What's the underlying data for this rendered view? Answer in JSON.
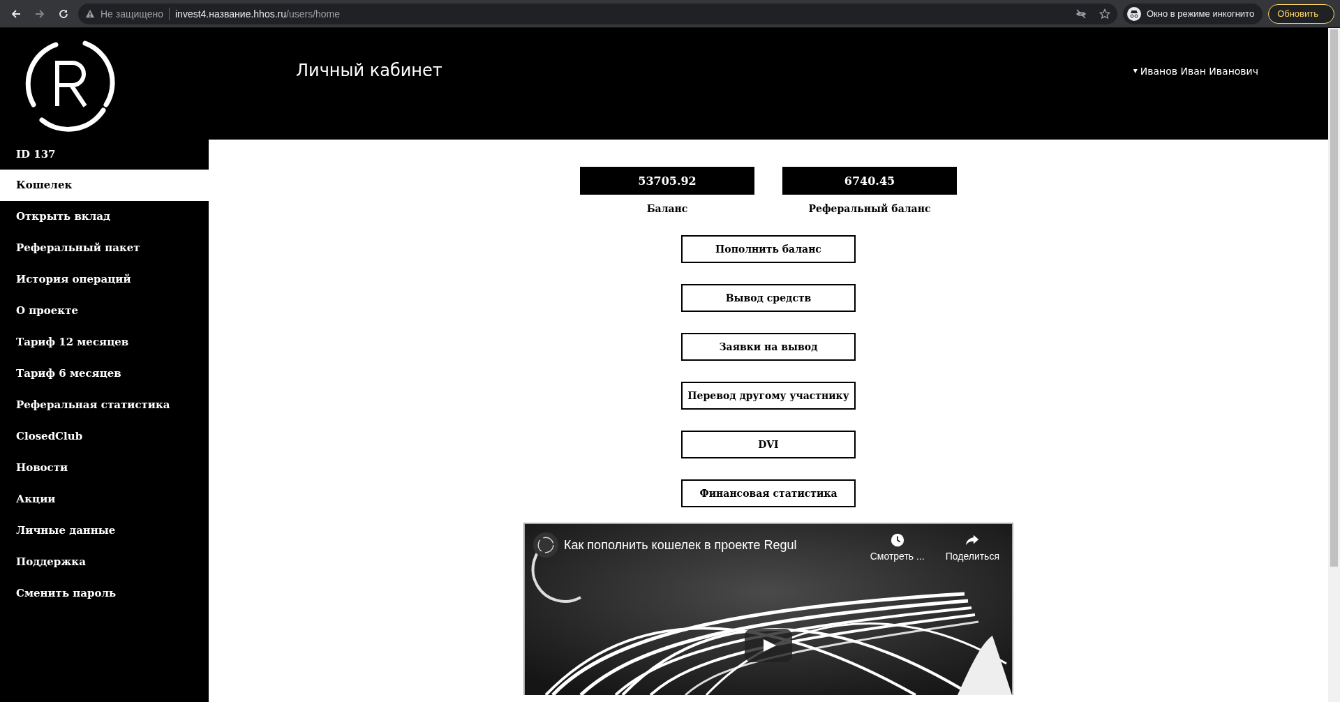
{
  "browser": {
    "security": "Не защищено",
    "url_host": "invest4.название.hhos.ru",
    "url_path": "/users/home",
    "incognito": "Окно в режиме инкогнито",
    "update_button": "Обновить"
  },
  "header": {
    "title": "Личный кабинет",
    "user": "Иванов Иван Иванович",
    "user_caret": "▾"
  },
  "sidebar": {
    "user_id": "ID 137",
    "items": [
      {
        "label": "Кошелек",
        "selected": true
      },
      {
        "label": "Открыть вклад",
        "selected": false
      },
      {
        "label": "Реферальный пакет",
        "selected": false
      },
      {
        "label": "История операций",
        "selected": false
      },
      {
        "label": "О проекте",
        "selected": false
      },
      {
        "label": "Тариф 12 месяцев",
        "selected": false
      },
      {
        "label": "Тариф 6 месяцев",
        "selected": false
      },
      {
        "label": "Реферальная статистика",
        "selected": false
      },
      {
        "label": "ClosedClub",
        "selected": false
      },
      {
        "label": "Новости",
        "selected": false
      },
      {
        "label": "Акции",
        "selected": false
      },
      {
        "label": "Личные данные",
        "selected": false
      },
      {
        "label": "Поддержка",
        "selected": false
      },
      {
        "label": "Сменить пароль",
        "selected": false
      }
    ]
  },
  "balances": [
    {
      "value": "53705.92",
      "label": "Баланс"
    },
    {
      "value": "6740.45",
      "label": "Реферальный баланс"
    }
  ],
  "actions": [
    "Пополнить баланс",
    "Вывод средств",
    "Заявки на вывод",
    "Перевод другому участнику",
    "DVI",
    "Финансовая статистика"
  ],
  "video": {
    "kind": "picture",
    "title": "Как пополнить кошелек в проекте Regul",
    "watch_later": "Смотреть ...",
    "share": "Поделиться"
  }
}
